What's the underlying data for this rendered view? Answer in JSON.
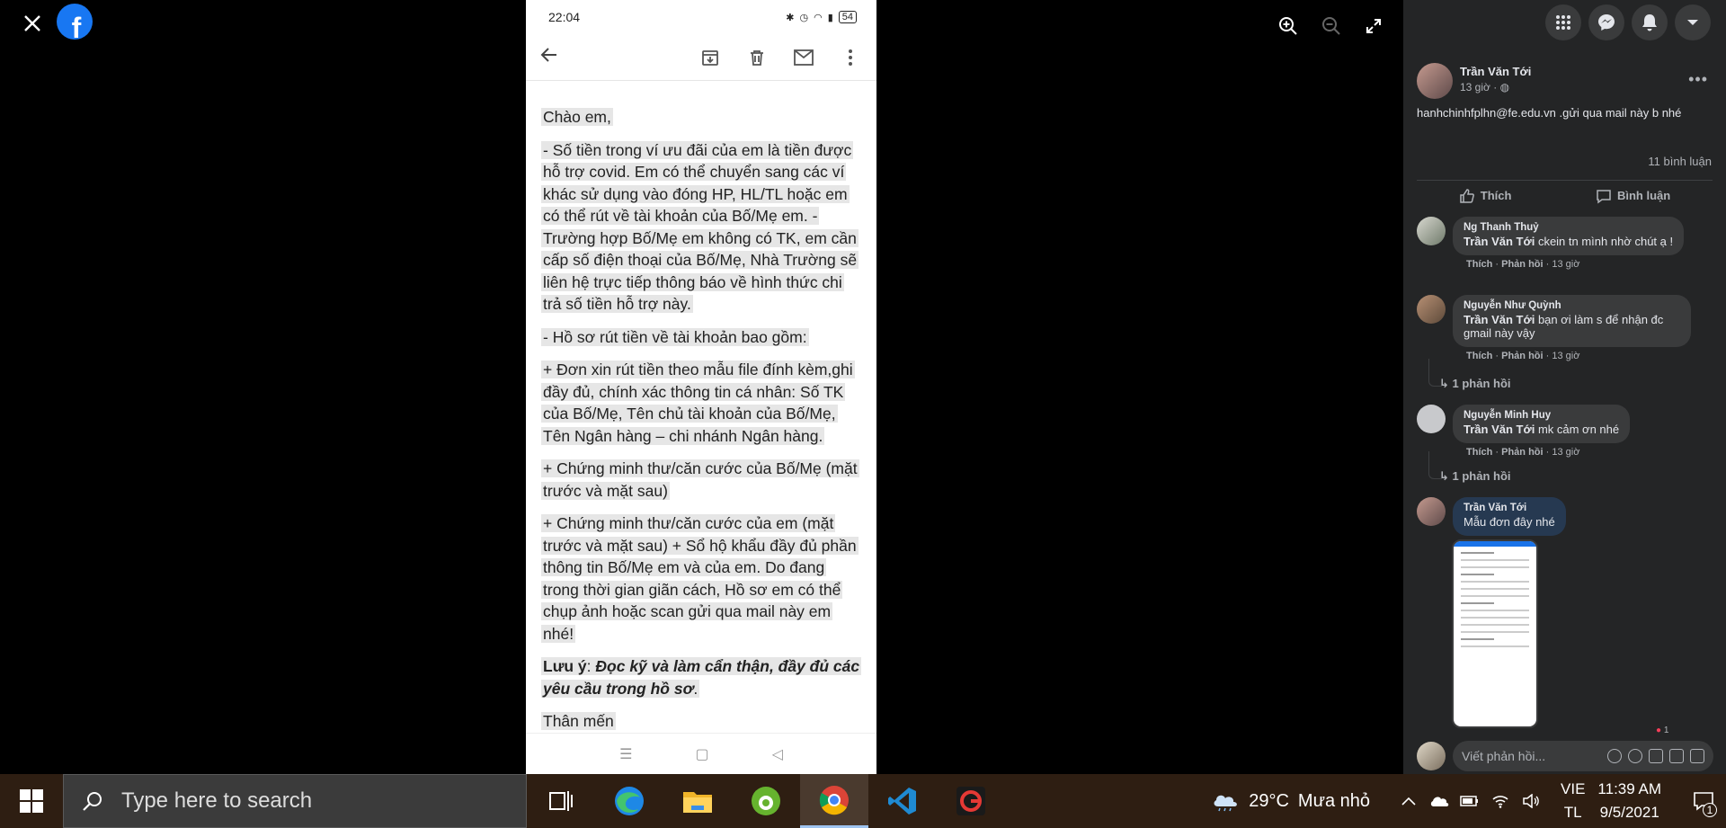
{
  "viewer": {
    "brand_letter": "f"
  },
  "phone": {
    "status_time": "22:04",
    "battery": "54",
    "greeting": "Chào em,",
    "para1": "- Số tiền trong ví ưu đãi của em là tiền được hỗ trợ covid. Em có thể chuyển sang các ví khác sử dụng vào đóng HP, HL/TL hoặc em có thể rút về tài khoản của Bố/Mẹ em. - Trường hợp Bố/Mẹ em không có TK, em cần cấp số điện thoại của Bố/Mẹ, Nhà Trường sẽ liên hệ trực tiếp thông báo về hình thức chi trả số tiền hỗ trợ này.",
    "para2": "- Hồ sơ rút tiền về tài khoản bao gồm:",
    "para3": "+ Đơn xin rút tiền theo mẫu file đính kèm,ghi đầy đủ, chính xác thông tin cá nhân: Số TK của Bố/Mẹ, Tên chủ tài khoản của Bố/Mẹ, Tên Ngân hàng – chi nhánh Ngân hàng.",
    "para4": "+ Chứng minh thư/căn cước của Bố/Mẹ (mặt trước và mặt sau)",
    "para5": "+ Chứng minh thư/căn cước của em (mặt trước và mặt sau) + Sổ hộ khẩu đầy đủ phần thông tin Bố/Mẹ em và của em. Do đang trong thời gian giãn cách, Hồ sơ em có thể chụp ảnh hoặc scan gửi qua mail này em nhé!",
    "note_label": "Lưu ý",
    "note_text": "Đọc kỹ và làm cẩn thận, đầy đủ các yêu cầu trong hồ sơ",
    "closing": "Thân mến"
  },
  "post": {
    "author": "Trần Văn Tới",
    "time": "13 giờ · ",
    "text": "hanhchinhfplhn@fe.edu.vn .gửi qua mail này b nhé",
    "comment_count": "11 bình luận",
    "like_label": "Thích",
    "comment_label": "Bình luận"
  },
  "comments": [
    {
      "name": "Ng Thanh Thuỷ",
      "tag": "Trần Văn Tới",
      "text": " ckein tn mình nhờ chút ạ !",
      "like": "Thích",
      "reply": "Phản hồi",
      "time": "13 giờ"
    },
    {
      "name": "Nguyễn Như Quỳnh",
      "tag": "Trần Văn Tới",
      "text": " bạn ơi làm s để nhận đc gmail này vậy",
      "like": "Thích",
      "reply": "Phản hồi",
      "time": "13 giờ",
      "replies": "1 phản hồi"
    },
    {
      "name": "Nguyễn Minh Huy",
      "tag": "Trần Văn Tới",
      "text": " mk cảm ơn nhé",
      "like": "Thích",
      "reply": "Phản hồi",
      "time": "13 giờ",
      "replies": "1 phản hồi"
    },
    {
      "name": "Trần Văn Tới",
      "text": "Mẫu đơn đây nhé"
    }
  ],
  "reaction_count": "1",
  "write": {
    "placeholder": "Viết phản hồi..."
  },
  "taskbar": {
    "search_placeholder": "Type here to search",
    "weather_temp": "29°C",
    "weather_text": "Mưa nhỏ",
    "lang_top": "VIE",
    "lang_bottom": "TL",
    "time": "11:39 AM",
    "date": "9/5/2021",
    "notif_count": "1"
  },
  "colors": {
    "facebook_blue": "#1877f2",
    "panel_bg": "#242526",
    "taskbar_bg": "#2e1e12"
  }
}
